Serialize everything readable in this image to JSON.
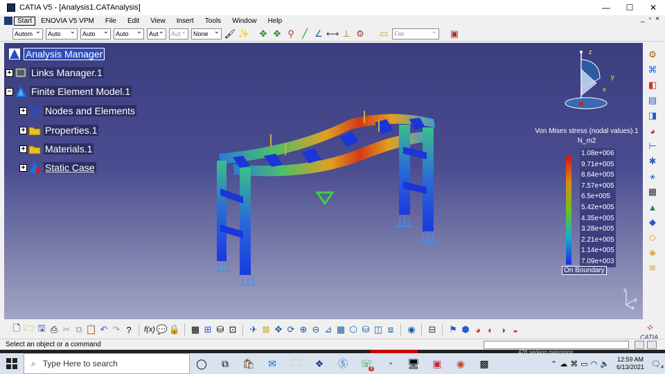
{
  "window": {
    "title": "CATIA V5 - [Analysis1.CATAnalysis]",
    "controls": [
      "—",
      "☐",
      "✕"
    ]
  },
  "menu": {
    "items": [
      "Start",
      "ENOVIA V5 VPM",
      "File",
      "Edit",
      "View",
      "Insert",
      "Tools",
      "Window",
      "Help"
    ],
    "mdi_controls": [
      "_",
      "▫",
      "×"
    ]
  },
  "toolbar": {
    "dropdowns": [
      "Autom",
      "Auto",
      "Auto",
      "Auto",
      "Aut",
      "Aut",
      "None"
    ],
    "file_dropdown": "File"
  },
  "tree": {
    "nodes": [
      {
        "label": "Analysis Manager"
      },
      {
        "label": "Links Manager.1"
      },
      {
        "label": "Finite Element Model.1"
      },
      {
        "label": "Nodes and Elements"
      },
      {
        "label": "Properties.1"
      },
      {
        "label": "Materials.1"
      },
      {
        "label": "Static Case"
      }
    ]
  },
  "compass": {
    "x": "x",
    "y": "y",
    "z": "z"
  },
  "axis_triad": {
    "x": "x",
    "y": "y",
    "z": "z"
  },
  "legend": {
    "title": "Von Mises stress (nodal values).1",
    "unit": "N_m2",
    "values": [
      "1.08e+006",
      "9.71e+005",
      "8.64e+005",
      "7.57e+005",
      "6.5e+005",
      "5.42e+005",
      "4.35e+005",
      "3.28e+005",
      "2.21e+005",
      "1.14e+005",
      "7.09e+003"
    ],
    "boundary": "On Boundary"
  },
  "status": {
    "message": "Select an object or a command"
  },
  "taskbar": {
    "search_placeholder": "Here to search",
    "search_prefix": "Type",
    "time": "12:59 AM",
    "date": "6/13/2021",
    "notification_count": "4",
    "badge": "9",
    "watch_text": "428 sedang menonton",
    "subscribe": "SUBSCRIBE"
  },
  "logo": "CATIA"
}
